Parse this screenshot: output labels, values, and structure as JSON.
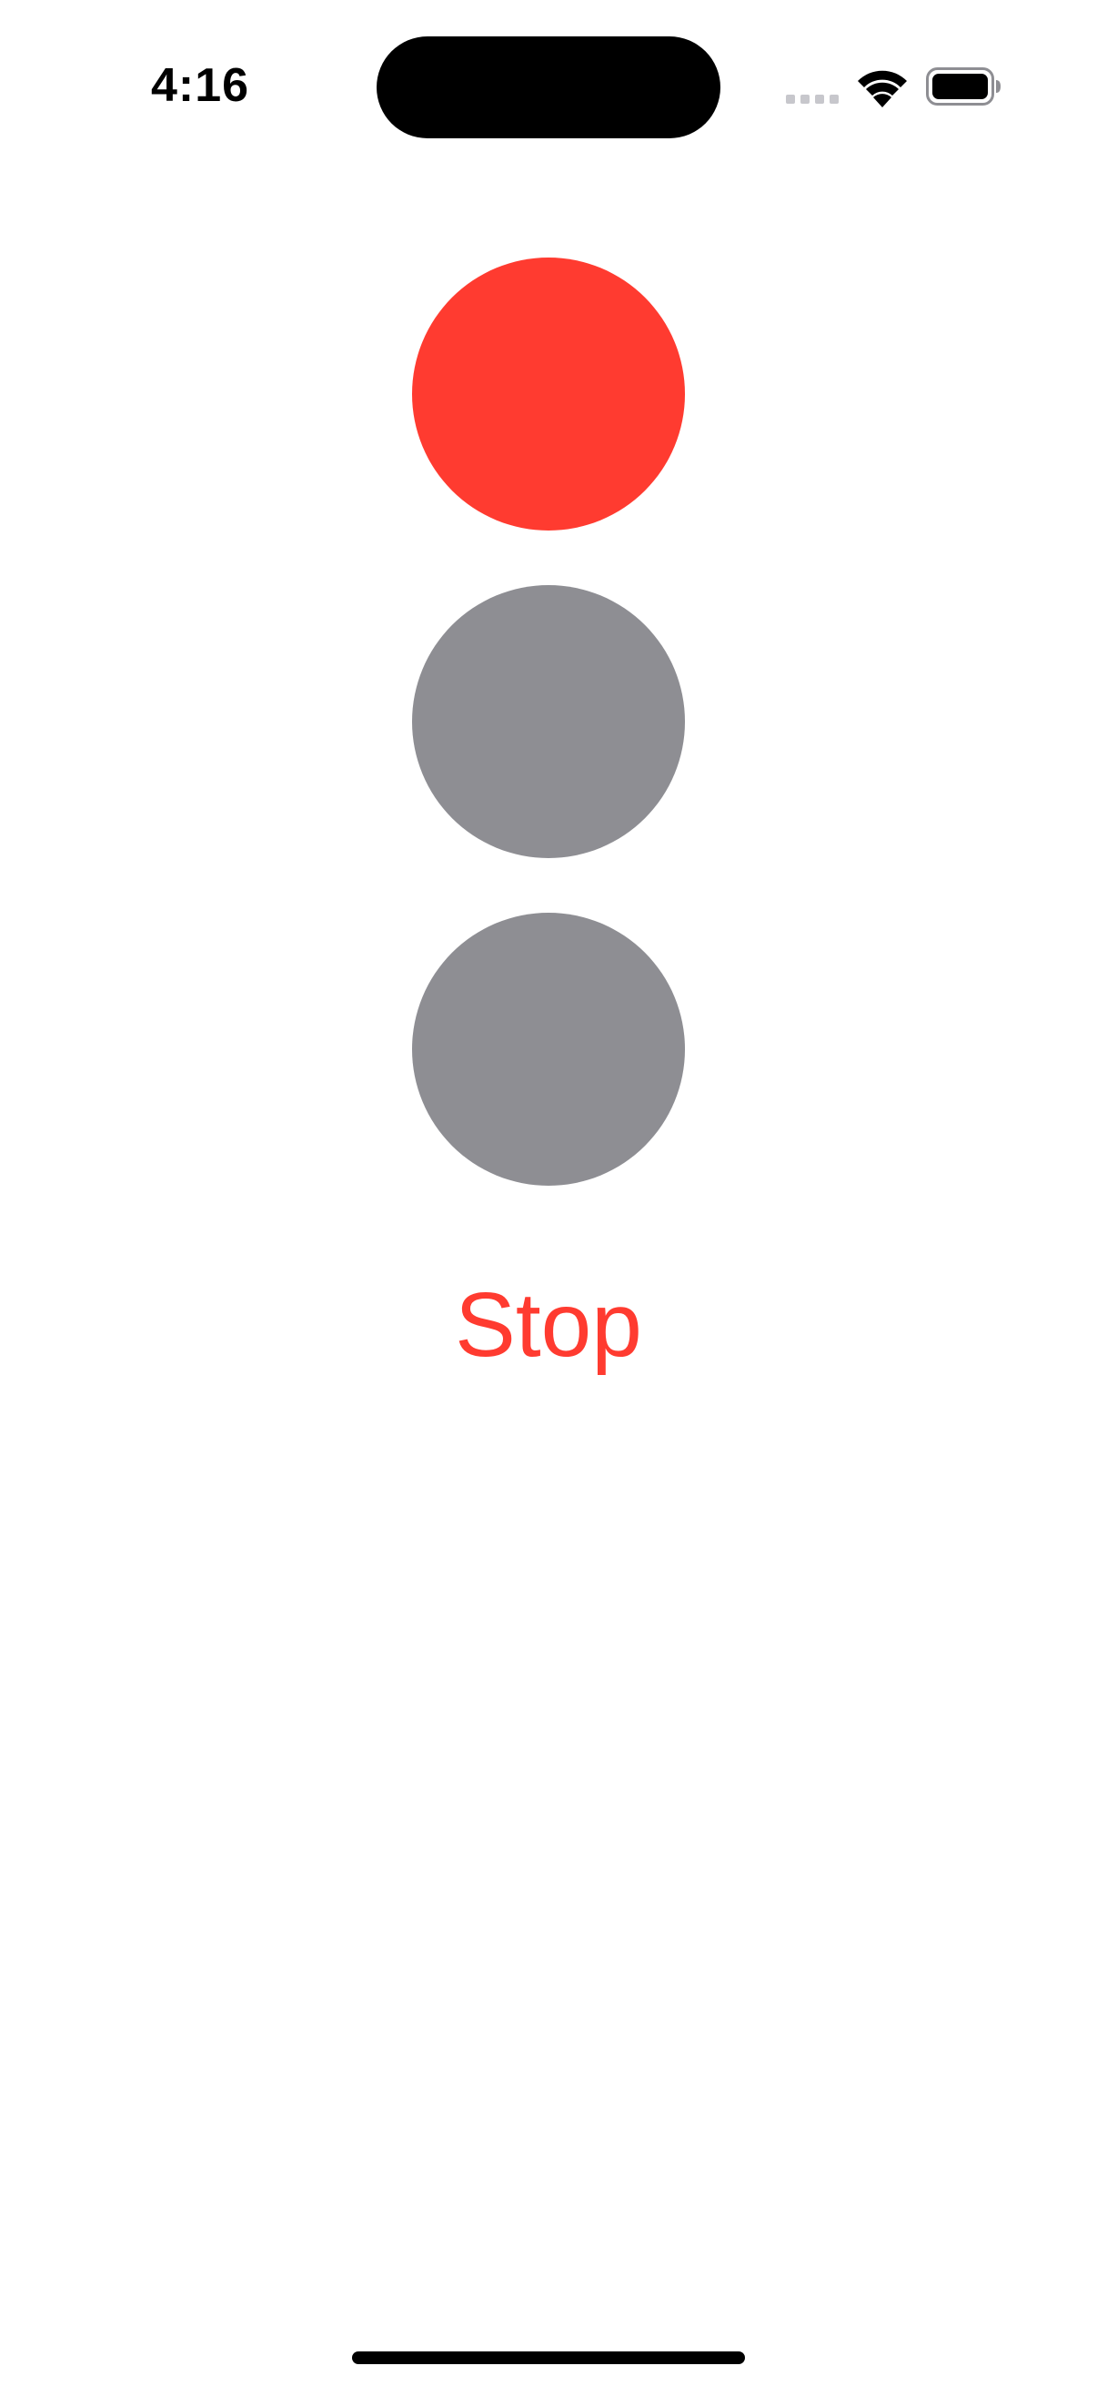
{
  "status_bar": {
    "time": "4:16",
    "icons": {
      "signal": "cellular-signal-icon",
      "wifi": "wifi-icon",
      "battery": "battery-icon"
    }
  },
  "traffic_light": {
    "active": "red",
    "lights": [
      {
        "name": "red",
        "color": "#FF3B30",
        "state": "on"
      },
      {
        "name": "yellow",
        "color": "#8E8E93",
        "state": "off"
      },
      {
        "name": "green",
        "color": "#8E8E93",
        "state": "off"
      }
    ],
    "label": "Stop",
    "label_color": "#FF3B30"
  }
}
